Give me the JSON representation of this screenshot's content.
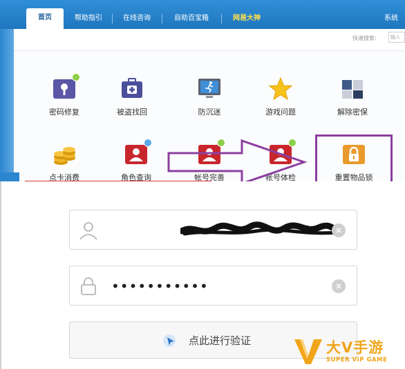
{
  "nav": {
    "tabs": [
      {
        "label": "首页",
        "active": true
      },
      {
        "label": "帮助指引",
        "active": false
      },
      {
        "label": "在线咨询",
        "active": false
      },
      {
        "label": "自助百宝箱",
        "active": false
      },
      {
        "label": "网易大神",
        "active": false,
        "highlight": true
      }
    ],
    "right_label": "系统"
  },
  "search": {
    "label": "快速搜索:",
    "placeholder": "输入"
  },
  "tools": [
    {
      "label": "密码修复",
      "icon": "key-icon"
    },
    {
      "label": "被盗找回",
      "icon": "medkit-icon"
    },
    {
      "label": "防沉迷",
      "icon": "running-monitor-icon"
    },
    {
      "label": "游戏问题",
      "icon": "star-icon"
    },
    {
      "label": "解除密保",
      "icon": "unlock-blocks-icon"
    },
    {
      "label": "点卡消费",
      "icon": "coins-icon"
    },
    {
      "label": "角色查询",
      "icon": "role-card-icon"
    },
    {
      "label": "帐号完善",
      "icon": "account-complete-icon"
    },
    {
      "label": "帐号体检",
      "icon": "account-check-icon"
    },
    {
      "label": "重置物品锁",
      "icon": "lock-icon"
    }
  ],
  "login": {
    "username_value": "",
    "password_value": "•••••••••••",
    "verify_label": "点此进行验证"
  },
  "watermark": {
    "brand": "大V手游",
    "sub": "SUPER VIP GAME"
  },
  "colors": {
    "nav_blue": "#1f76bf",
    "highlight_purple": "#8b3fa0",
    "watermark_orange": "#f0a51a"
  }
}
